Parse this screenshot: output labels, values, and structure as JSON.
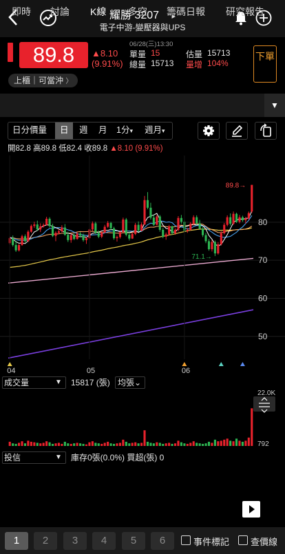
{
  "header": {
    "stock_name": "耀勝",
    "stock_code": "3207",
    "subtitle": "電子中游-變壓器與UPS",
    "next_arrow": "▸"
  },
  "quote": {
    "price": "89.8",
    "change": "▲8.10",
    "change_pct": "(9.91%)",
    "datetime": "06/28(三)13:30",
    "unit_volume_label": "單量",
    "unit_volume_value": "15",
    "total_volume_label": "總量",
    "total_volume_value": "15713",
    "est_volume_label": "估量",
    "est_volume_value": "15713",
    "volume_increase_label": "量增",
    "volume_increase_value": "104%",
    "sell_button": "下單",
    "market_tag": "上櫃｜可當沖",
    "market_tag_arrow": "〉"
  },
  "tabs": [
    {
      "label": "即時"
    },
    {
      "label": "討論"
    },
    {
      "label": "K線",
      "active": true
    },
    {
      "label": "多空"
    },
    {
      "label": "籌碼日報"
    },
    {
      "label": "研究報告"
    }
  ],
  "tab_dropdown": "▼",
  "toolbar": {
    "volume_mode": "日分價量",
    "period_day": "日",
    "period_week": "週",
    "period_month": "月",
    "minute": "1分",
    "minute_arrow": "▾",
    "week_month": "週月",
    "week_month_arrow": "▾"
  },
  "ohlc": {
    "open_label": "開",
    "open": "82.8",
    "high_label": "高",
    "high": "89.8",
    "low_label": "低",
    "low": "82.4",
    "close_label": "收",
    "close": "89.8",
    "change": "▲8.10",
    "change_pct": "(9.91%)"
  },
  "chart_data": {
    "type": "candlestick",
    "y_ticks": [
      "80",
      "70",
      "60",
      "50"
    ],
    "ylim": [
      44,
      91
    ],
    "x_ticks": [
      "04",
      "05",
      "06"
    ],
    "annotation_high": "89.8",
    "annotation_low": "71.1",
    "candles": [
      [
        74.5,
        76.2,
        74.1,
        75.8
      ],
      [
        75.8,
        76.5,
        73.6,
        74.0
      ],
      [
        74.0,
        75.1,
        72.2,
        72.6
      ],
      [
        72.6,
        74.3,
        72.3,
        74.0
      ],
      [
        74.0,
        76.7,
        73.8,
        76.3
      ],
      [
        76.3,
        76.8,
        74.7,
        75.0
      ],
      [
        75.0,
        77.9,
        74.8,
        77.5
      ],
      [
        77.5,
        79.4,
        77.2,
        79.0
      ],
      [
        79.0,
        80.1,
        78.5,
        79.4
      ],
      [
        79.4,
        80.4,
        77.7,
        78.1
      ],
      [
        78.1,
        79.7,
        77.4,
        78.9
      ],
      [
        78.9,
        79.7,
        78.6,
        79.3
      ],
      [
        79.3,
        81.4,
        79.1,
        80.9
      ],
      [
        80.9,
        81.3,
        78.6,
        79.0
      ],
      [
        79.0,
        79.6,
        76.1,
        76.4
      ],
      [
        76.4,
        77.6,
        75.0,
        77.2
      ],
      [
        77.2,
        78.2,
        76.8,
        77.6
      ],
      [
        77.6,
        79.2,
        77.3,
        78.6
      ],
      [
        78.6,
        79.5,
        76.4,
        76.7
      ],
      [
        76.7,
        77.5,
        74.8,
        75.3
      ],
      [
        75.3,
        77.0,
        74.6,
        76.6
      ],
      [
        76.6,
        77.0,
        75.3,
        75.6
      ],
      [
        75.6,
        77.4,
        75.4,
        77.0
      ],
      [
        77.0,
        77.4,
        76.0,
        76.5
      ],
      [
        76.5,
        77.0,
        74.9,
        75.3
      ],
      [
        75.3,
        76.1,
        74.3,
        75.8
      ],
      [
        75.8,
        78.5,
        75.5,
        78.1
      ],
      [
        78.1,
        80.2,
        77.7,
        79.7
      ],
      [
        79.7,
        80.1,
        76.9,
        77.2
      ],
      [
        77.2,
        77.8,
        75.8,
        76.2
      ],
      [
        76.2,
        77.6,
        75.8,
        77.3
      ],
      [
        77.3,
        79.3,
        77.1,
        78.8
      ],
      [
        78.8,
        80.3,
        78.5,
        79.8
      ],
      [
        79.8,
        80.1,
        78.0,
        78.4
      ],
      [
        78.4,
        78.8,
        75.4,
        75.8
      ],
      [
        75.8,
        76.5,
        74.9,
        76.1
      ],
      [
        76.1,
        77.8,
        75.7,
        77.4
      ],
      [
        77.4,
        81.2,
        77.2,
        80.7
      ],
      [
        80.7,
        81.1,
        76.3,
        76.7
      ],
      [
        76.7,
        77.4,
        75.2,
        75.7
      ],
      [
        75.7,
        77.3,
        75.6,
        76.9
      ],
      [
        76.9,
        79.8,
        76.6,
        79.3
      ],
      [
        79.3,
        80.2,
        77.4,
        77.8
      ],
      [
        77.8,
        79.9,
        77.6,
        79.4
      ],
      [
        79.4,
        86.9,
        79.3,
        85.8
      ],
      [
        85.8,
        87.9,
        83.4,
        83.8
      ],
      [
        83.8,
        85.1,
        80.7,
        81.2
      ],
      [
        81.2,
        81.9,
        79.0,
        79.3
      ],
      [
        79.3,
        81.9,
        79.2,
        81.5
      ],
      [
        81.5,
        81.9,
        77.5,
        78.0
      ],
      [
        78.0,
        78.5,
        75.8,
        76.2
      ],
      [
        76.2,
        77.3,
        75.4,
        76.8
      ],
      [
        76.8,
        79.3,
        76.5,
        78.9
      ],
      [
        78.9,
        79.1,
        76.7,
        77.1
      ],
      [
        77.1,
        78.4,
        76.7,
        78.0
      ],
      [
        78.0,
        81.6,
        77.6,
        81.1
      ],
      [
        81.1,
        81.9,
        79.6,
        80.1
      ],
      [
        80.1,
        80.6,
        77.4,
        77.7
      ],
      [
        77.7,
        78.5,
        77.2,
        78.0
      ],
      [
        78.0,
        80.0,
        77.8,
        79.6
      ],
      [
        79.6,
        81.8,
        79.2,
        81.3
      ],
      [
        81.3,
        81.8,
        79.3,
        79.7
      ],
      [
        79.7,
        80.6,
        78.0,
        78.3
      ],
      [
        78.3,
        78.8,
        76.1,
        76.6
      ],
      [
        76.6,
        77.2,
        74.5,
        75.0
      ],
      [
        75.0,
        75.6,
        72.5,
        72.9
      ],
      [
        72.9,
        75.3,
        72.3,
        74.8
      ],
      [
        74.8,
        75.2,
        71.1,
        71.8
      ],
      [
        71.8,
        74.8,
        71.5,
        74.2
      ],
      [
        74.2,
        77.6,
        73.9,
        77.1
      ],
      [
        77.1,
        79.8,
        76.8,
        79.3
      ],
      [
        79.3,
        81.8,
        78.9,
        81.3
      ],
      [
        81.3,
        82.3,
        79.1,
        79.6
      ],
      [
        79.6,
        82.8,
        79.3,
        82.2
      ],
      [
        82.2,
        82.5,
        79.8,
        80.1
      ],
      [
        80.1,
        81.9,
        79.7,
        81.3
      ],
      [
        81.3,
        81.7,
        80.1,
        80.5
      ],
      [
        80.5,
        81.4,
        79.6,
        81.0
      ],
      [
        81.0,
        82.8,
        80.6,
        82.4
      ],
      [
        82.8,
        89.8,
        82.4,
        89.8
      ]
    ],
    "volume_label": "成交量",
    "volume_value": "15817 (張)",
    "volume_ma": "均張",
    "volume_ma_arrow": "⌄",
    "volume_scale_max": "22.0K",
    "volume_scale_min": "792",
    "volumes": [
      0.08,
      0.05,
      0.04,
      0.06,
      0.09,
      0.05,
      0.1,
      0.08,
      0.07,
      0.06,
      0.05,
      0.06,
      0.09,
      0.07,
      0.04,
      0.05,
      0.06,
      0.04,
      0.08,
      0.05,
      0.04,
      0.05,
      0.06,
      0.05,
      0.04,
      0.03,
      0.07,
      0.09,
      0.06,
      0.05,
      0.04,
      0.06,
      0.08,
      0.05,
      0.04,
      0.05,
      0.06,
      0.12,
      0.08,
      0.05,
      0.06,
      0.07,
      0.05,
      0.06,
      0.3,
      0.08,
      0.06,
      0.05,
      0.07,
      0.06,
      0.04,
      0.05,
      0.06,
      0.04,
      0.05,
      0.1,
      0.07,
      0.05,
      0.04,
      0.06,
      0.09,
      0.06,
      0.05,
      0.04,
      0.05,
      0.08,
      0.06,
      0.12,
      0.09,
      0.1,
      0.12,
      0.14,
      0.1,
      0.09,
      0.14,
      0.1,
      0.08,
      0.1,
      0.16,
      0.72
    ]
  },
  "indicator2": {
    "name": "投信",
    "text": "庫存0張(0.0%)  買超(張) 0",
    "scale_value": "0"
  },
  "bottom": {
    "pages": [
      "1",
      "2",
      "3",
      "4",
      "5",
      "6"
    ],
    "event_label": "事件標記",
    "price_line_label": "查價線"
  },
  "colors": {
    "up": "#e8222c",
    "down": "#2db552",
    "accent": "#e08a23"
  }
}
